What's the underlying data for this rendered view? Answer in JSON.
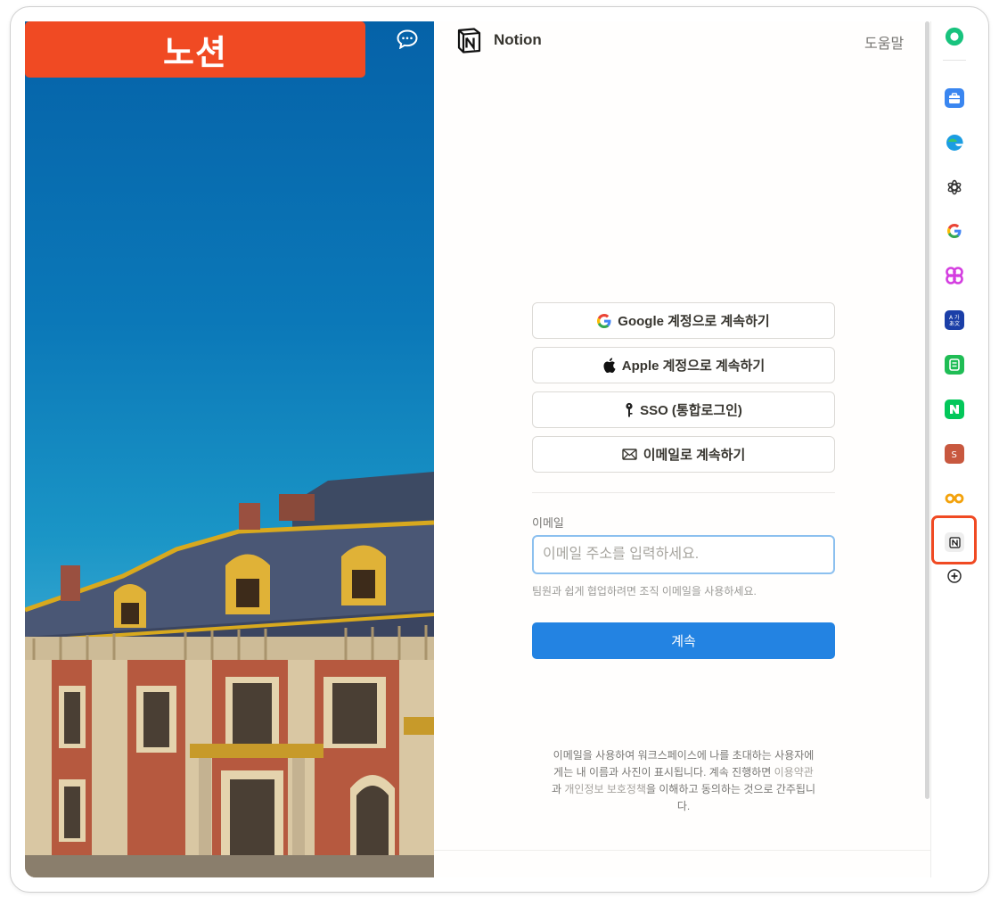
{
  "banner": {
    "title": "노션"
  },
  "header": {
    "brand": "Notion",
    "help": "도움말"
  },
  "auth": {
    "google": "Google 계정으로 계속하기",
    "apple": "Apple 계정으로 계속하기",
    "sso": "SSO (통합로그인)",
    "email": "이메일로 계속하기"
  },
  "form": {
    "label": "이메일",
    "placeholder": "이메일 주소를 입력하세요.",
    "hint": "팀원과 쉽게 협업하려면 조직 이메일을 사용하세요.",
    "continue": "계속"
  },
  "terms": {
    "text_before": "이메일을 사용하여 워크스페이스에 나를 초대하는 사용자에게는 내 이름과 사진이 표시됩니다. 계속 진행하면 ",
    "terms_link": "이용약관",
    "and": "과 ",
    "privacy_link": "개인정보 보호정책",
    "text_after": "을 이해하고 동의하는 것으로 간주됩니다."
  },
  "sidebar": {
    "icons": [
      "home-app-icon",
      "briefcase-icon",
      "edge-icon",
      "chatgpt-icon",
      "google-icon",
      "butterfly-app-icon",
      "translate-icon",
      "note-icon",
      "naver-icon",
      "s-app-icon",
      "infinity-icon",
      "notion-icon",
      "add-icon"
    ],
    "accent": "#f04a23"
  }
}
